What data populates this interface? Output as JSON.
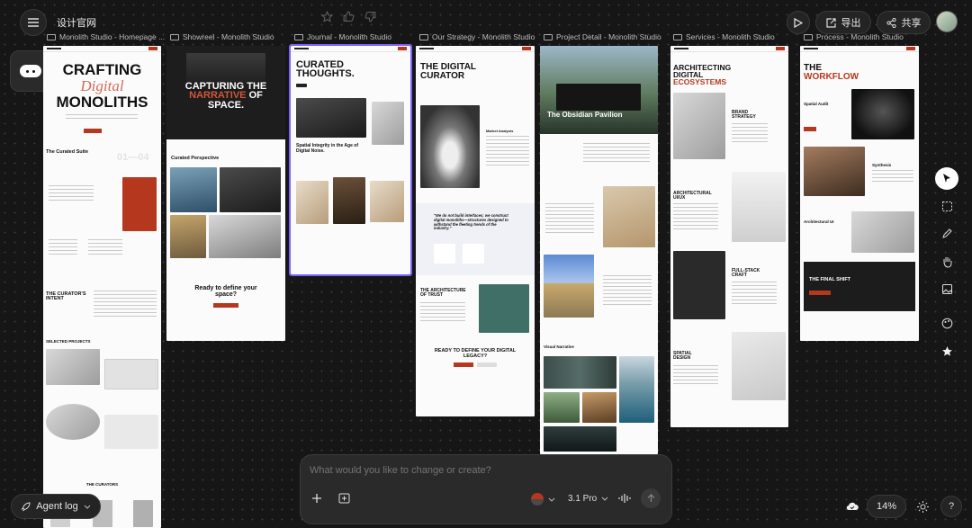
{
  "header": {
    "project_title": "设计官网",
    "export_label": "导出",
    "share_label": "共享"
  },
  "frames": [
    {
      "title": "Monolith Studio - Homepage ..."
    },
    {
      "title": "Showreel - Monolith Studio"
    },
    {
      "title": "Journal - Monolith Studio"
    },
    {
      "title": "Our Strategy - Monolith Studio"
    },
    {
      "title": "Project Detail - Monolith Studio"
    },
    {
      "title": "Services - Monolith Studio"
    },
    {
      "title": "Process - Monolith Studio"
    }
  ],
  "homepage": {
    "l1": "CRAFTING",
    "l2": "Digital",
    "l3": "MONOLITHS",
    "suite": "The Curated Suite",
    "count": "01—04",
    "intent": "THE CURATOR'S INTENT",
    "projects": "SELECTED PROJECTS",
    "curators": "THE CURATORS"
  },
  "showreel": {
    "l1": "CAPTURING THE",
    "l2": "NARRATIVE",
    "l3": "OF",
    "l4": "SPACE.",
    "perspective": "Curated Perspective",
    "cta": "Ready to define your space?"
  },
  "journal": {
    "l1": "CURATED",
    "l2": "THOUGHTS.",
    "article": "Spatial Integrity in the Age of Digital Noise."
  },
  "strategy": {
    "l1": "THE DIGITAL",
    "l2": "CURATOR",
    "market": "Market Analysis",
    "quote": "\"We do not build interfaces; we construct digital monoliths—structures designed to withstand the fleeting trends of the industry.\"",
    "arch": "THE ARCHITECTURE OF TRUST",
    "legacy": "READY TO DEFINE YOUR DIGITAL LEGACY?"
  },
  "project": {
    "hero": "The Obsidian Pavilion",
    "visual": "Visual Narrative"
  },
  "services": {
    "l1": "ARCHITECTING",
    "l2": "DIGITAL",
    "l3": "ECOSYSTEMS",
    "brand": "BRAND STRATEGY",
    "ux": "ARCHITECTURAL UI/UX",
    "fullstack": "FULL-STACK CRAFT",
    "spatial": "SPATIAL DESIGN"
  },
  "process": {
    "l1": "THE",
    "l2": "WORKFLOW",
    "audit": "Spatial Audit",
    "synthesis": "Synthesis",
    "ui": "Architectural UI",
    "shift": "THE FINAL SHIFT"
  },
  "prompt": {
    "placeholder": "What would you like to change or create?",
    "model": "3.1 Pro"
  },
  "footer": {
    "agent_log": "Agent log",
    "zoom": "14%"
  },
  "colors": {
    "accent": "#b5381e",
    "selection": "#7b61ff",
    "canvas": "#161616"
  }
}
